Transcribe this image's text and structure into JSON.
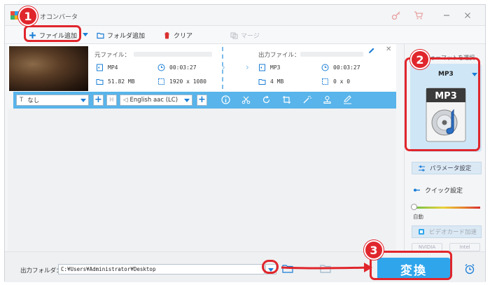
{
  "app": {
    "title": "オコンバータ"
  },
  "toolbar": {
    "add_file": "ファイル追加",
    "add_folder": "フォルダ追加",
    "clear": "クリア",
    "merge": "マージ"
  },
  "file": {
    "source_label": "元ファイル：",
    "source_format": "MP4",
    "source_duration": "00:03:27",
    "source_size": "51.82 MB",
    "source_resolution": "1920 x 1080",
    "output_label": "出力ファイル：",
    "output_format": "MP3",
    "output_duration": "00:03:27",
    "output_size": "4 MB",
    "output_resolution": "0 x 0"
  },
  "editbar": {
    "subtitle": "なし",
    "audio_track": "English aac (LC)"
  },
  "right_panel": {
    "output_format_label": "出力フォーマットを選択",
    "format": "MP3",
    "format_icon_text": "MP3",
    "params": "パラメータ設定",
    "quick": "クイック設定",
    "auto": "自動",
    "gpu": "ビデオカード加速",
    "vendor_nvidia": "NVIDIA",
    "vendor_intel": "Intel"
  },
  "bottom": {
    "output_folder_label": "出力フォルダ：",
    "output_path": "C:¥Users¥Administrator¥Desktop",
    "convert": "変換"
  },
  "annotations": {
    "step1": "1",
    "step2": "2",
    "step3": "3",
    "color": "#e0262c"
  },
  "colors": {
    "accent": "#2fa6ec",
    "editbar": "#58b4ea",
    "format_card": "#cfe6f6"
  }
}
